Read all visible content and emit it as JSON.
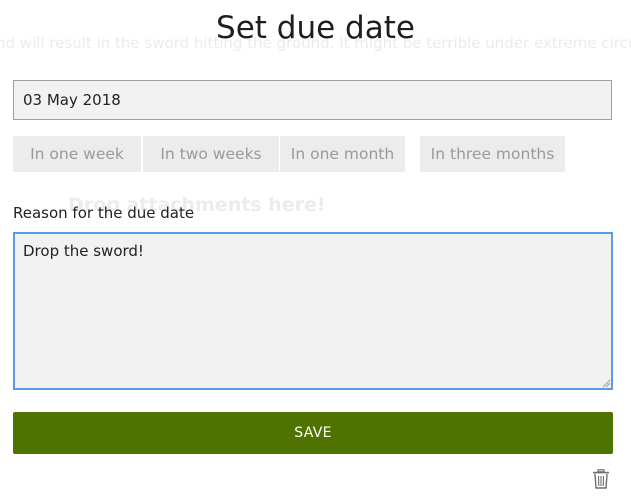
{
  "background": {
    "text": "nd will result in the sword hitting the ground. It might be terrible under extreme circu",
    "drop_hint": "Drop attachments here!"
  },
  "dialog": {
    "title": "Set due date",
    "date_value": "03 May 2018",
    "quick_options": [
      "In one week",
      "In two weeks",
      "In one month",
      "In three months"
    ],
    "reason_label": "Reason for the due date",
    "reason_value": "Drop the sword!",
    "save_label": "SAVE"
  },
  "colors": {
    "save_button": "#4e7301",
    "focus_border": "#5a9ae6"
  },
  "icons": {
    "delete": "trash-icon"
  }
}
